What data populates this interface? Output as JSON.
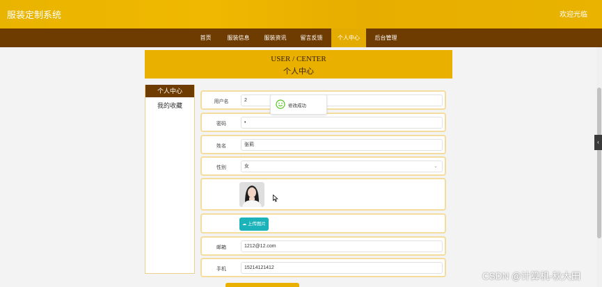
{
  "header": {
    "brand": "服装定制系统",
    "welcome": "欢迎光临"
  },
  "nav": {
    "items": [
      "首页",
      "服装信息",
      "服装资讯",
      "留言反馈",
      "个人中心",
      "后台管理"
    ],
    "active_index": 4
  },
  "hero": {
    "title_en": "USER / CENTER",
    "title_cn": "个人中心"
  },
  "sidebar": {
    "items": [
      "个人中心",
      "我的收藏"
    ],
    "active_index": 0
  },
  "form": {
    "username": {
      "label": "用户名",
      "value": "2"
    },
    "password": {
      "label": "密码",
      "value": "•"
    },
    "name": {
      "label": "姓名",
      "value": "张莉"
    },
    "gender": {
      "label": "性别",
      "value": "女"
    },
    "upload_label": "上传图片",
    "email": {
      "label": "邮箱",
      "value": "1212@12.com"
    },
    "phone": {
      "label": "手机",
      "value": "15214121412"
    }
  },
  "toast": {
    "message": "修改成功"
  },
  "watermark": "CSDN @计算机-秋大田",
  "colors": {
    "accent": "#e9b000",
    "nav_bg": "#6e3b00",
    "upload_button": "#1bb3b9",
    "toast_icon": "#52c41a"
  },
  "icons": {
    "toast": "smile-icon",
    "upload": "cloud-upload-icon",
    "select": "chevron-down-icon",
    "cursor": "mouse-cursor-icon",
    "edge_tab": "chevron-left-icon"
  }
}
